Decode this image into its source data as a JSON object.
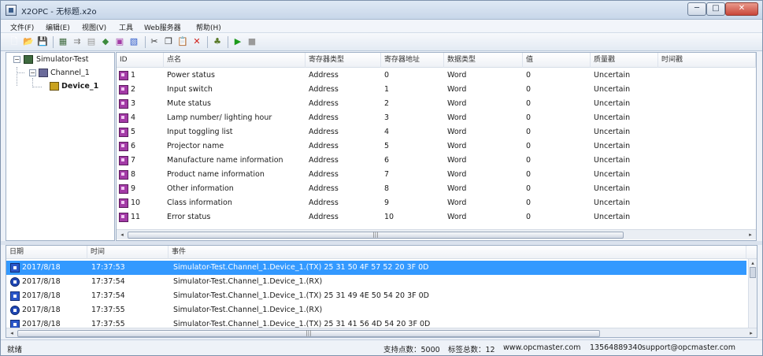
{
  "window": {
    "title": "X2OPC - 无标题.x2o",
    "btn_min": "─",
    "btn_max": "□",
    "btn_close": "✕"
  },
  "menu": {
    "items": [
      "文件(F)",
      "编辑(E)",
      "视图(V)",
      "工具",
      "Web服务器",
      "帮助(H)"
    ]
  },
  "toolbar": {
    "icons": [
      {
        "name": "new-icon",
        "glyph": "🗋",
        "color": "#ffffff"
      },
      {
        "name": "open-icon",
        "glyph": "📂",
        "color": "#e8b93a"
      },
      {
        "name": "save-icon",
        "glyph": "💾",
        "color": "#4a6fa5"
      },
      {
        "name": "new-server-icon",
        "glyph": "▦",
        "color": "#3f6a3f"
      },
      {
        "name": "new-channel-icon",
        "glyph": "⇉",
        "color": "#7a7a7a"
      },
      {
        "name": "new-device-icon",
        "glyph": "▤",
        "color": "#9a9a9a"
      },
      {
        "name": "new-tag-icon",
        "glyph": "◆",
        "color": "#3c8a3c"
      },
      {
        "name": "new-tags-icon",
        "glyph": "▣",
        "color": "#a33ba6"
      },
      {
        "name": "properties-icon",
        "glyph": "▧",
        "color": "#2b57c9"
      },
      {
        "name": "cut-icon",
        "glyph": "✂",
        "color": "#333333"
      },
      {
        "name": "copy-icon",
        "glyph": "❐",
        "color": "#333333"
      },
      {
        "name": "paste-icon",
        "glyph": "📋",
        "color": "#8a6a2a"
      },
      {
        "name": "delete-icon",
        "glyph": "✕",
        "color": "#d0201a"
      },
      {
        "name": "monitor-icon",
        "glyph": "♣",
        "color": "#5a7a2a"
      },
      {
        "name": "run-icon",
        "glyph": "▶",
        "color": "#1a9a1a"
      },
      {
        "name": "stop-icon",
        "glyph": "■",
        "color": "#9a9a9a"
      }
    ]
  },
  "tree": {
    "server": "Simulator-Test",
    "channel": "Channel_1",
    "device": "Device_1",
    "collapse_glyph": "−"
  },
  "grid": {
    "columns": [
      "ID",
      "点名",
      "寄存器类型",
      "寄存器地址",
      "数据类型",
      "值",
      "质量戳",
      "时间戳"
    ],
    "rows": [
      {
        "id": "1",
        "name": "Power status",
        "reg_type": "Address",
        "reg_addr": "0",
        "data_type": "Word",
        "value": "0",
        "quality": "Uncertain",
        "timestamp": ""
      },
      {
        "id": "2",
        "name": "Input switch",
        "reg_type": "Address",
        "reg_addr": "1",
        "data_type": "Word",
        "value": "0",
        "quality": "Uncertain",
        "timestamp": ""
      },
      {
        "id": "3",
        "name": "Mute status",
        "reg_type": "Address",
        "reg_addr": "2",
        "data_type": "Word",
        "value": "0",
        "quality": "Uncertain",
        "timestamp": ""
      },
      {
        "id": "4",
        "name": "Lamp number/ lighting hour",
        "reg_type": "Address",
        "reg_addr": "3",
        "data_type": "Word",
        "value": "0",
        "quality": "Uncertain",
        "timestamp": ""
      },
      {
        "id": "5",
        "name": "Input toggling list",
        "reg_type": "Address",
        "reg_addr": "4",
        "data_type": "Word",
        "value": "0",
        "quality": "Uncertain",
        "timestamp": ""
      },
      {
        "id": "6",
        "name": "Projector name",
        "reg_type": "Address",
        "reg_addr": "5",
        "data_type": "Word",
        "value": "0",
        "quality": "Uncertain",
        "timestamp": ""
      },
      {
        "id": "7",
        "name": "Manufacture name information",
        "reg_type": "Address",
        "reg_addr": "6",
        "data_type": "Word",
        "value": "0",
        "quality": "Uncertain",
        "timestamp": ""
      },
      {
        "id": "8",
        "name": "Product name information",
        "reg_type": "Address",
        "reg_addr": "7",
        "data_type": "Word",
        "value": "0",
        "quality": "Uncertain",
        "timestamp": ""
      },
      {
        "id": "9",
        "name": "Other information",
        "reg_type": "Address",
        "reg_addr": "8",
        "data_type": "Word",
        "value": "0",
        "quality": "Uncertain",
        "timestamp": ""
      },
      {
        "id": "10",
        "name": "Class information",
        "reg_type": "Address",
        "reg_addr": "9",
        "data_type": "Word",
        "value": "0",
        "quality": "Uncertain",
        "timestamp": ""
      },
      {
        "id": "11",
        "name": "Error status",
        "reg_type": "Address",
        "reg_addr": "10",
        "data_type": "Word",
        "value": "0",
        "quality": "Uncertain",
        "timestamp": ""
      }
    ],
    "scroll_left": "◂",
    "scroll_right": "▸",
    "scroll_grip": "|||"
  },
  "log": {
    "columns": [
      "日期",
      "时间",
      "事件"
    ],
    "rows": [
      {
        "date": "2017/8/18",
        "time": "17:37:53",
        "event": "Simulator-Test.Channel_1.Device_1.(TX) 25 31 50 4F 57 52 20 3F 0D",
        "dir": "tx",
        "selected": true
      },
      {
        "date": "2017/8/18",
        "time": "17:37:54",
        "event": "Simulator-Test.Channel_1.Device_1.(RX)",
        "dir": "rx",
        "selected": false
      },
      {
        "date": "2017/8/18",
        "time": "17:37:54",
        "event": "Simulator-Test.Channel_1.Device_1.(TX) 25 31 49 4E 50 54 20 3F 0D",
        "dir": "tx",
        "selected": false
      },
      {
        "date": "2017/8/18",
        "time": "17:37:55",
        "event": "Simulator-Test.Channel_1.Device_1.(RX)",
        "dir": "rx",
        "selected": false
      },
      {
        "date": "2017/8/18",
        "time": "17:37:55",
        "event": "Simulator-Test.Channel_1.Device_1.(TX) 25 31 41 56 4D 54 20 3F 0D",
        "dir": "tx",
        "selected": false
      }
    ],
    "scroll_left": "◂",
    "scroll_right": "▸",
    "scroll_up": "▴"
  },
  "status": {
    "ready": "就绪",
    "supported_points": "支持点数：5000",
    "total_tags": "标签总数：12",
    "website": "www.opcmaster.com",
    "phone": "13564889340",
    "email": "support@opcmaster.com"
  }
}
